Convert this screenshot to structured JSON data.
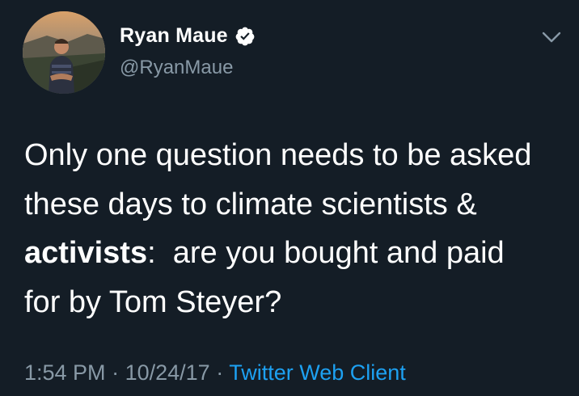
{
  "user": {
    "display_name": "Ryan Maue",
    "handle": "@RyanMaue",
    "verified": true
  },
  "tweet": {
    "line1": "Only one question needs to be asked",
    "line2": "these days to climate scientists &",
    "line3_bold": "activists",
    "line3_rest": ":  are you bought and paid",
    "line4": "for by Tom Steyer?"
  },
  "meta": {
    "time": "1:54 PM",
    "separator": "·",
    "date": "10/24/17",
    "source": "Twitter Web Client"
  },
  "colors": {
    "background": "#141d26",
    "secondary_text": "#8899a6",
    "link": "#1da1f2",
    "verified_badge": "#ffffff"
  },
  "icons": {
    "verified": "verified-badge-icon",
    "menu": "chevron-down-icon"
  }
}
